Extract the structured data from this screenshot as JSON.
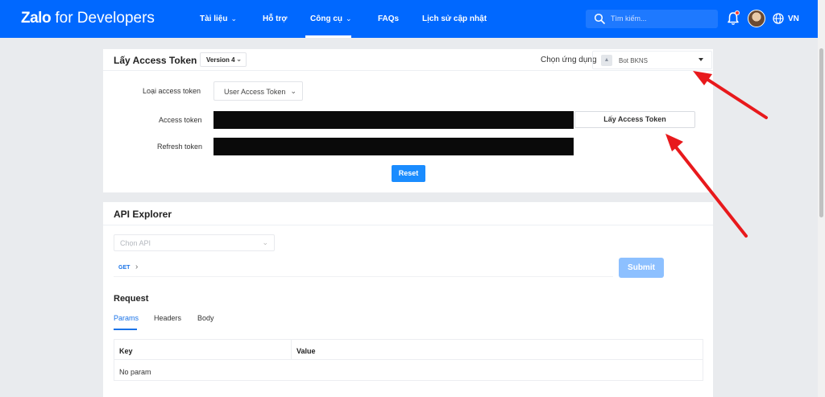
{
  "nav": {
    "logo_bold": "Zalo",
    "logo_rest": "for Developers",
    "items": [
      {
        "label": "Tài liệu",
        "has_dropdown": true
      },
      {
        "label": "Hỗ trợ",
        "has_dropdown": false
      },
      {
        "label": "Công cụ",
        "has_dropdown": true,
        "active": true
      },
      {
        "label": "FAQs",
        "has_dropdown": false
      },
      {
        "label": "Lịch sử cập nhật",
        "has_dropdown": false
      }
    ],
    "search_placeholder": "Tìm kiếm...",
    "language": "VN",
    "icons": [
      "search-icon",
      "bell-icon",
      "avatar",
      "globe-icon"
    ]
  },
  "access_token_card": {
    "title": "Lấy Access Token",
    "version": "Version 4",
    "choose_app_label": "Chọn ứng dụng",
    "app_name": "Bot BKNS",
    "token_type_label": "Loại access token",
    "token_type_value": "User Access Token",
    "access_token_label": "Access token",
    "refresh_token_label": "Refresh token",
    "get_token_button": "Lấy Access Token",
    "reset_button": "Reset"
  },
  "api_explorer": {
    "title": "API Explorer",
    "api_select_placeholder": "Chọn API",
    "method": "GET",
    "submit_button": "Submit",
    "request_title": "Request",
    "tabs": [
      "Params",
      "Headers",
      "Body"
    ],
    "active_tab": "Params",
    "table": {
      "columns": [
        "Key",
        "Value"
      ],
      "empty_text": "No param"
    }
  },
  "colors": {
    "brand_blue": "#0068ff",
    "button_blue": "#1a8cff",
    "submit_disabled": "#8dc0ff",
    "annotation_red": "#e8191c"
  }
}
